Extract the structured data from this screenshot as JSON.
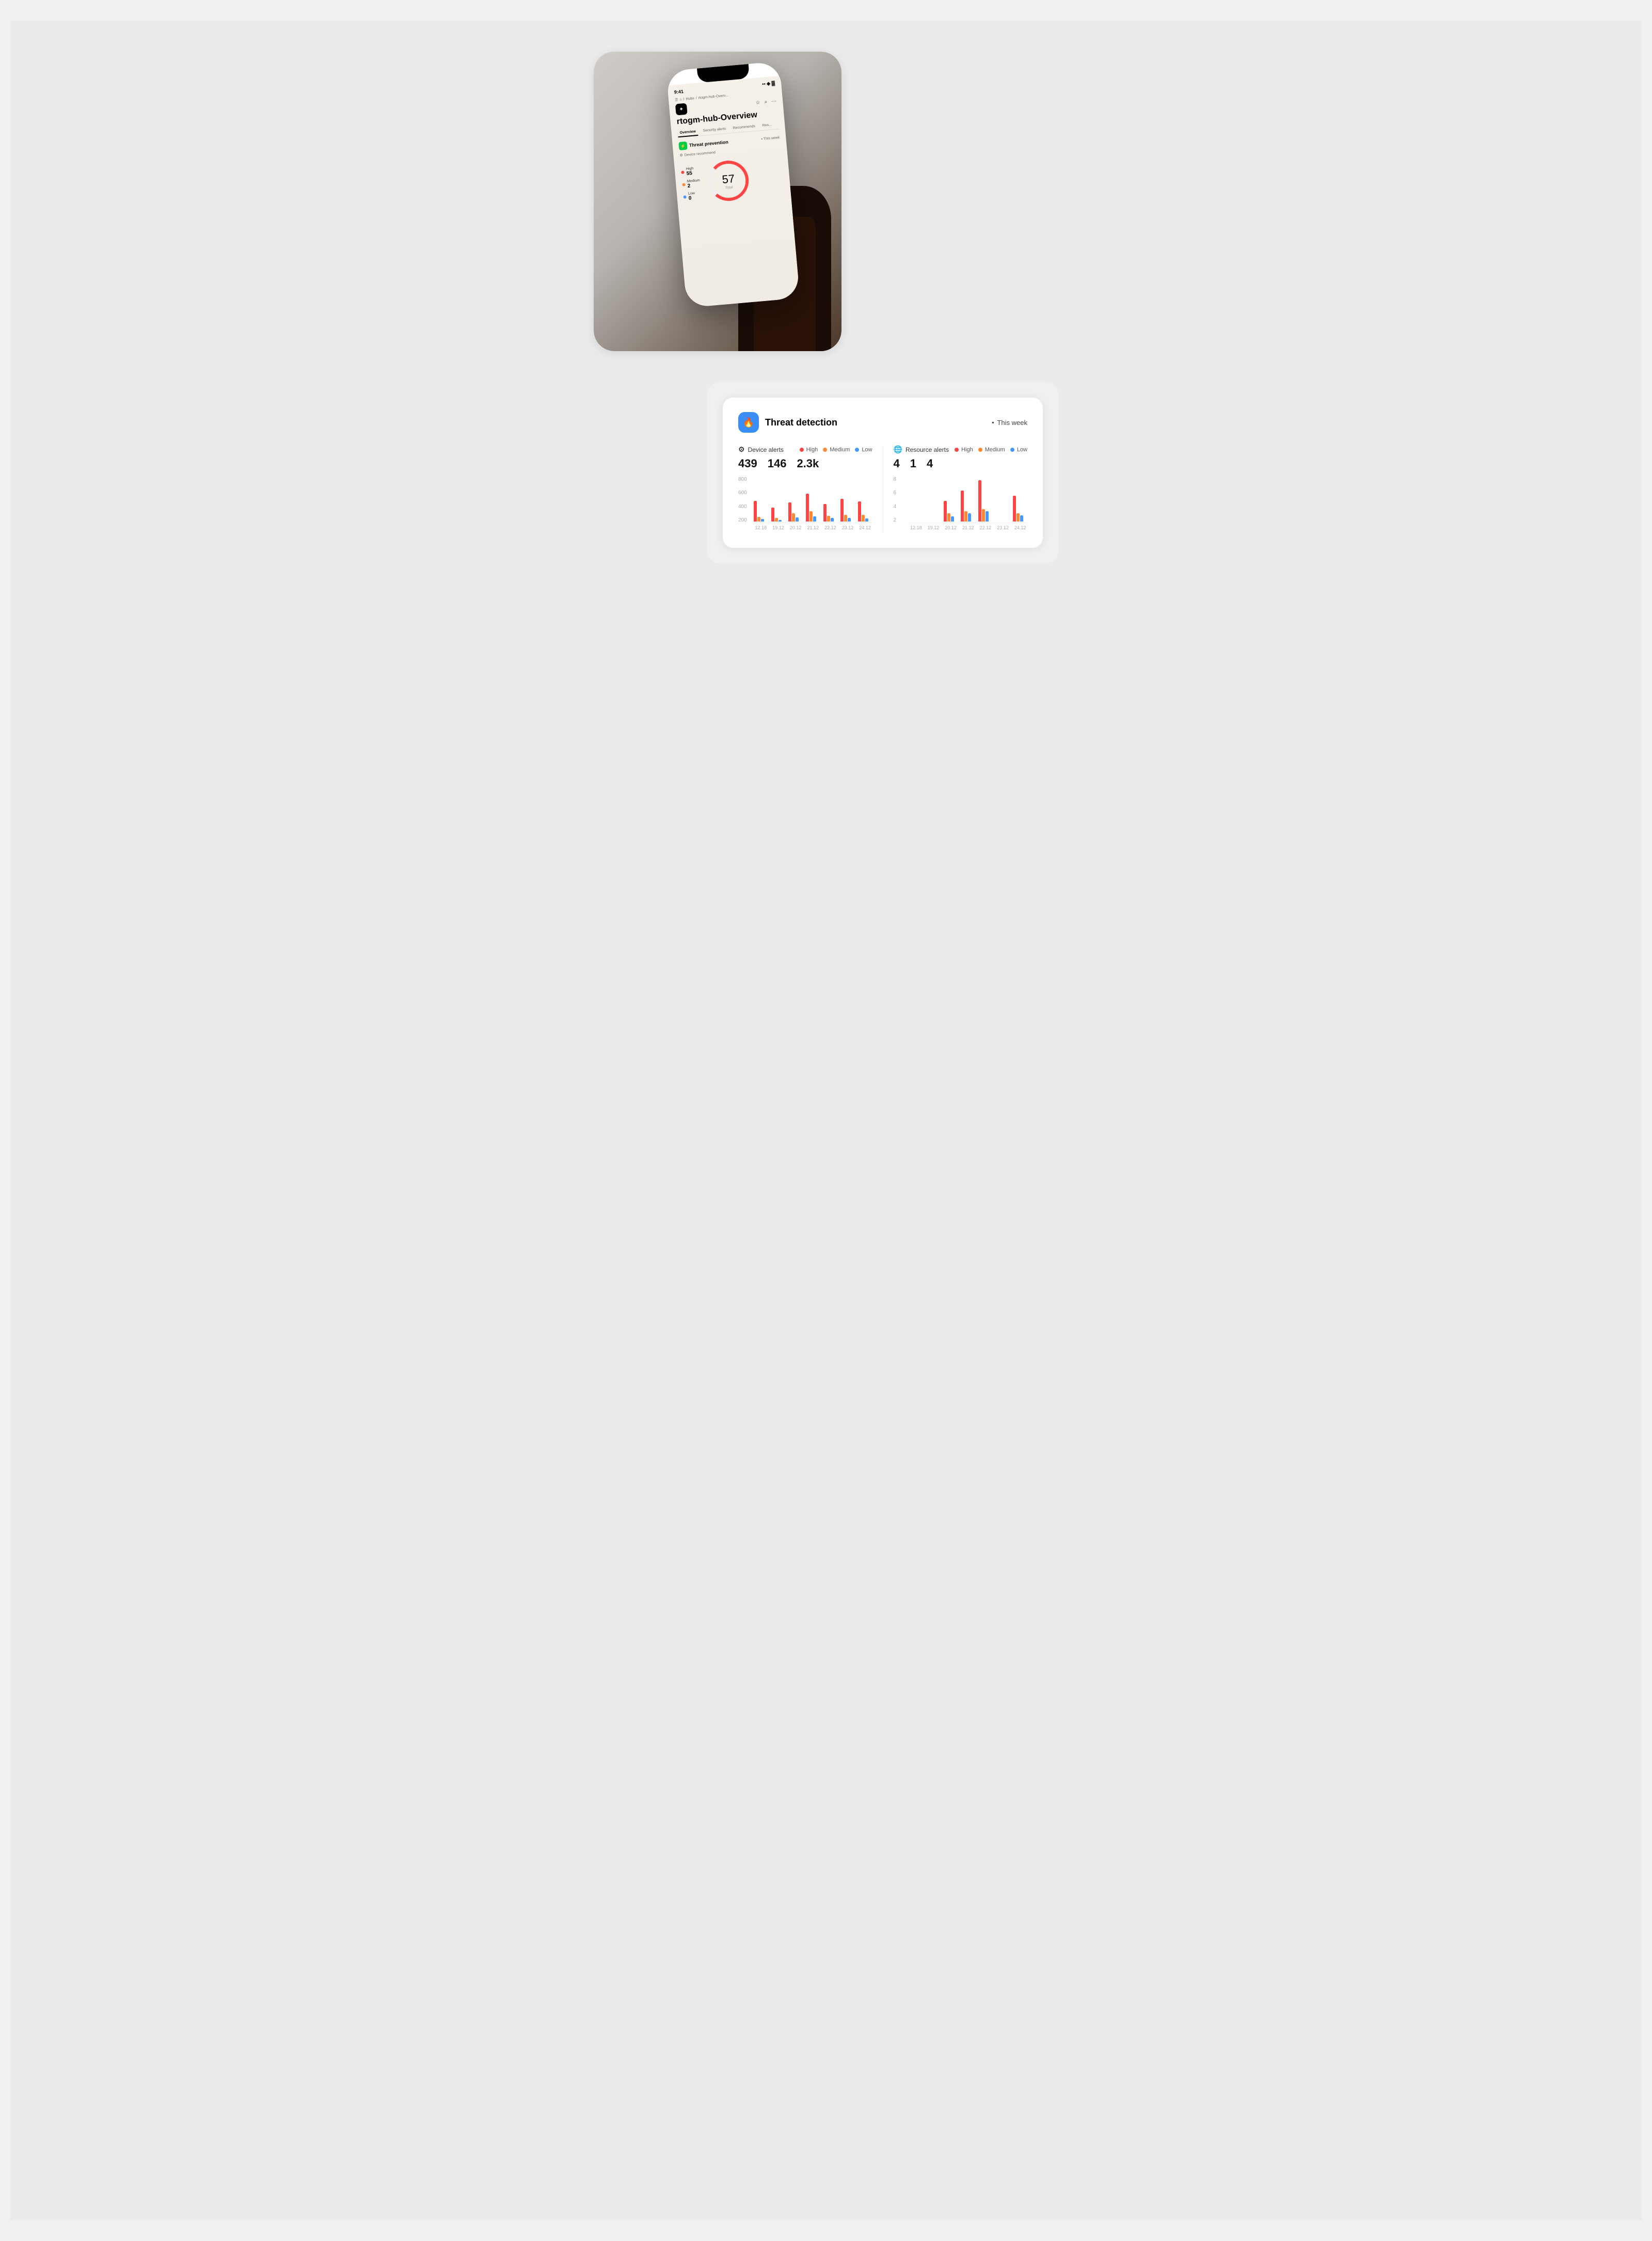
{
  "page": {
    "background": "#ebebeb"
  },
  "phone": {
    "time": "9:41",
    "breadcrumb": [
      "≡",
      "🏠",
      "/",
      "Hubs",
      "/",
      "rtogm-hub-Overv..."
    ],
    "page_title": "rtogm-hub-Overview",
    "tabs": [
      "Overview",
      "Security alerts",
      "Recommends",
      "Res..."
    ],
    "active_tab": "Overview",
    "threat_prevention": {
      "label": "Threat prevention",
      "this_week": "This week"
    },
    "device_recommend": "Device recommend",
    "legend": [
      {
        "color": "#ff4444",
        "label": "High",
        "value": "55"
      },
      {
        "color": "#ff8833",
        "label": "Medium",
        "value": "2"
      },
      {
        "color": "#4499ff",
        "label": "Low",
        "value": "0"
      }
    ],
    "gauge": {
      "value": "57",
      "label": "Total"
    }
  },
  "dashboard": {
    "card": {
      "title": "Threat detection",
      "period": "This week",
      "icon": "🔥"
    },
    "device_alerts": {
      "label": "Device alerts",
      "icon": "⚙️",
      "legend": [
        {
          "color": "#ff4444",
          "label": "High"
        },
        {
          "color": "#ff8833",
          "label": "Medium"
        },
        {
          "color": "#4499ff",
          "label": "Low"
        }
      ],
      "values": {
        "high": "439",
        "medium": "146",
        "low": "2.3k"
      },
      "y_axis": [
        "800",
        "600",
        "400",
        "200"
      ],
      "x_labels": [
        "12.18",
        "19.12",
        "20.12",
        "21.12",
        "22.12",
        "23.12",
        "24.12"
      ],
      "bars": [
        {
          "high": 60,
          "medium": 20,
          "low": 15
        },
        {
          "high": 40,
          "medium": 15,
          "low": 10
        },
        {
          "high": 55,
          "medium": 35,
          "low": 25
        },
        {
          "high": 80,
          "medium": 45,
          "low": 30
        },
        {
          "high": 50,
          "medium": 25,
          "low": 20
        },
        {
          "high": 65,
          "medium": 30,
          "low": 22
        },
        {
          "high": 58,
          "medium": 28,
          "low": 18
        }
      ]
    },
    "resource_alerts": {
      "label": "Resource alerts",
      "icon": "🌐",
      "legend": [
        {
          "color": "#ff4444",
          "label": "High"
        },
        {
          "color": "#ff8833",
          "label": "Medium"
        },
        {
          "color": "#4499ff",
          "label": "Low"
        }
      ],
      "values": {
        "high": "4",
        "medium": "1",
        "low": "4"
      },
      "y_axis": [
        "8",
        "6",
        "4",
        "2"
      ],
      "x_labels": [
        "12.18",
        "19.12",
        "20.12",
        "21.12",
        "22.12",
        "23.12",
        "24.12"
      ],
      "bars": [
        {
          "high": 0,
          "medium": 0,
          "low": 0
        },
        {
          "high": 0,
          "medium": 0,
          "low": 0
        },
        {
          "high": 20,
          "medium": 8,
          "low": 5
        },
        {
          "high": 30,
          "medium": 10,
          "low": 8
        },
        {
          "high": 40,
          "medium": 12,
          "low": 10
        },
        {
          "high": 0,
          "medium": 0,
          "low": 0
        },
        {
          "high": 25,
          "medium": 8,
          "low": 6
        }
      ]
    }
  }
}
